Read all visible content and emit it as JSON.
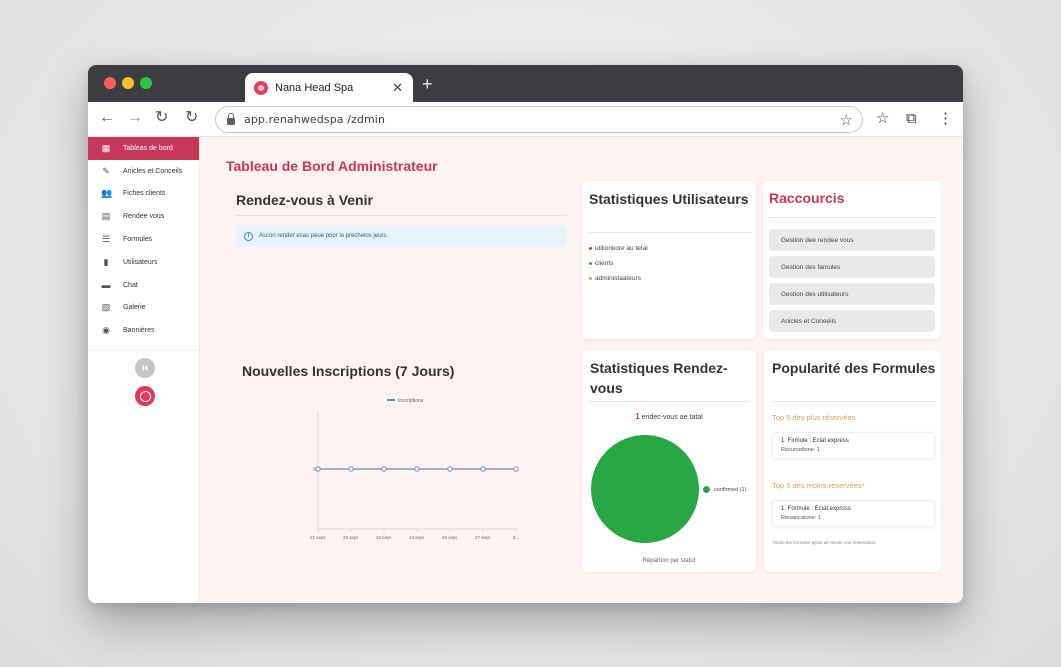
{
  "browser": {
    "tab_title": "Nana Head Spa",
    "tab_close": "✕",
    "new_tab": "+",
    "url": "app.renahwedspa /zdmin"
  },
  "sidebar": {
    "items": [
      {
        "label": "Tableas de bord",
        "icon": "dashboard-icon",
        "glyph": "▦"
      },
      {
        "label": "Anicles et Conceils",
        "icon": "magic-wand-icon",
        "glyph": "✎"
      },
      {
        "label": "Fiches clients",
        "icon": "users-icon",
        "glyph": "👥"
      },
      {
        "label": "Rendee vous",
        "icon": "calendar-icon",
        "glyph": "▤"
      },
      {
        "label": "Formules",
        "icon": "list-icon",
        "glyph": "☰"
      },
      {
        "label": "Utilisateurs",
        "icon": "document-icon",
        "glyph": "▮"
      },
      {
        "label": "Chat",
        "icon": "chat-icon",
        "glyph": "▬"
      },
      {
        "label": "Galerie",
        "icon": "gallery-icon",
        "glyph": "▧"
      },
      {
        "label": "Bannières",
        "icon": "camera-icon",
        "glyph": "◉"
      }
    ],
    "avatar_initial": "H"
  },
  "main": {
    "page_title": "Tableau de Bord Administrateur",
    "upcoming": {
      "title": "Rendez-vous à Venir",
      "info": "Ascon render esas peue poor le prechelos jeurs."
    },
    "user_stats": {
      "title": "Statistiques Utilisateurs",
      "items": [
        {
          "text": "utilionkore au tetal",
          "color": "#c6375a"
        },
        {
          "text": "clients",
          "color": "#28a745"
        },
        {
          "text": "administaateurs",
          "color": "#d8a15a"
        }
      ]
    },
    "shortcuts": {
      "title": "Raccourcis",
      "buttons": [
        "Gestion dee rendee vous",
        "Gestion des famules",
        "Gestion des utilisateurs",
        "Anicles et Coneeils"
      ]
    },
    "registrations": {
      "title": "Nouvelles Inscriptions (7 Jours)"
    },
    "appt_stats": {
      "title": "Statistiques Rendez-vous",
      "total_number": "1",
      "total_label": "endec-vous ae tatal",
      "caption": "Répartion per statut"
    },
    "popularity": {
      "title": "Popularité des Formules",
      "most_label": "Top 5 des plus réservées",
      "most_item": {
        "name": "1. Firmule : Eclat express",
        "count": "Resuroetione: 1"
      },
      "least_label": "Top 5 des moins réservées*",
      "least_item": {
        "name": "1. Formule : Eciat expross",
        "count": "Riesancatone: 1"
      },
      "note": "*Notre les formules ayant ae renote une réservation."
    }
  },
  "chart_data": [
    {
      "type": "line",
      "title": "",
      "series": [
        {
          "name": "Inscriptions",
          "values": [
            0,
            0,
            0,
            0,
            0,
            0,
            0
          ]
        }
      ],
      "categories": [
        "22 sept.",
        "23 sept.",
        "23 sept.",
        "24 sept.",
        "26 sept.",
        "27 sept.",
        "2..."
      ],
      "y_tick_labels": [
        "0"
      ],
      "color": "#6b83e0",
      "legend": "top"
    },
    {
      "type": "pie",
      "categories": [
        "confirmed (1)"
      ],
      "values": [
        1
      ],
      "color": "#28a745",
      "legend": "right"
    }
  ]
}
